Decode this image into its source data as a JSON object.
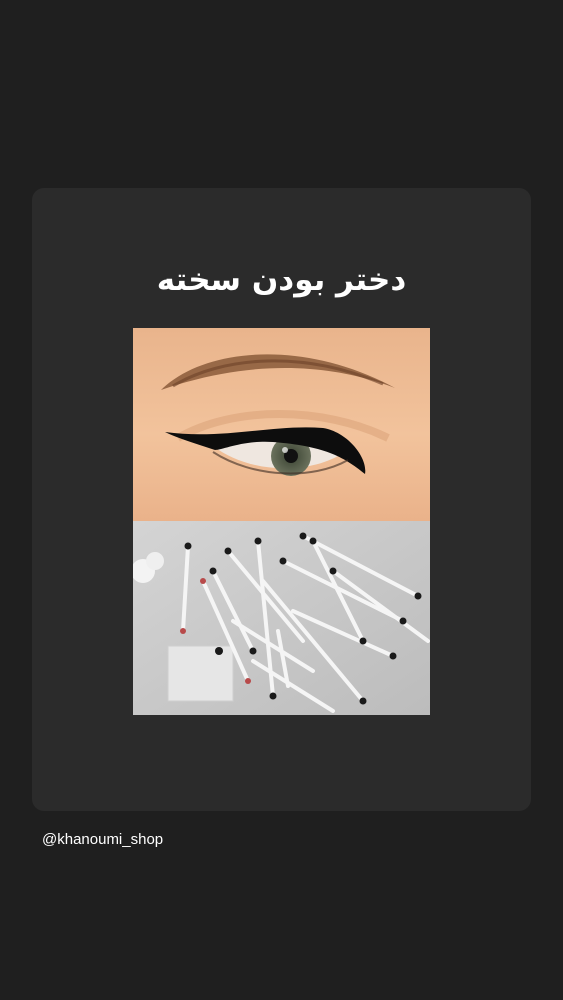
{
  "post": {
    "title": "دختر بودن سخته",
    "username": "@khanoumi_shop"
  },
  "images": {
    "top": "eye-with-winged-eyeliner",
    "bottom": "used-cotton-swabs"
  },
  "colors": {
    "background": "#1f1f1f",
    "card": "#2b2b2b",
    "text": "#ffffff"
  }
}
